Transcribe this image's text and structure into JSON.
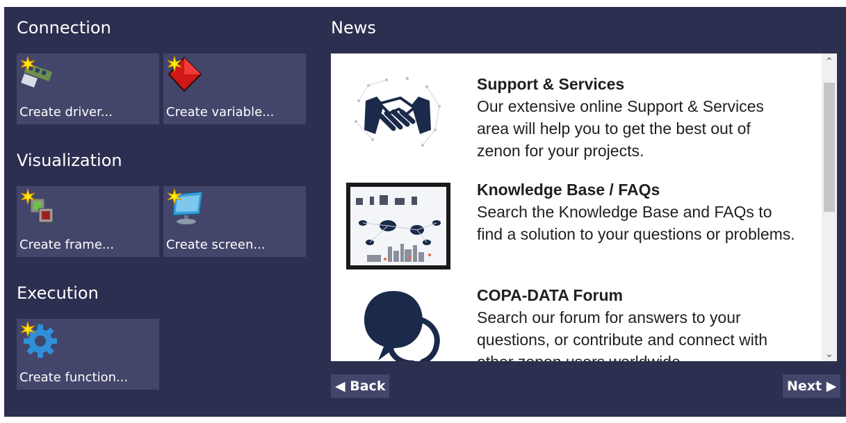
{
  "sections": {
    "connection": {
      "title": "Connection",
      "tiles": [
        {
          "label": "Create driver..."
        },
        {
          "label": "Create variable..."
        }
      ]
    },
    "visualization": {
      "title": "Visualization",
      "tiles": [
        {
          "label": "Create frame..."
        },
        {
          "label": "Create screen..."
        }
      ]
    },
    "execution": {
      "title": "Execution",
      "tiles": [
        {
          "label": "Create function..."
        }
      ]
    }
  },
  "news": {
    "title": "News",
    "items": [
      {
        "title": "Support & Services",
        "body": "Our extensive online Support & Services area will help you to get the best out of zenon for your projects.",
        "icon": "handshake-icon"
      },
      {
        "title": "Knowledge Base / FAQs",
        "body": "Search the Knowledge Base and FAQs to find a solution to your questions or problems.",
        "icon": "knowledge-base-image"
      },
      {
        "title": "COPA-DATA Forum",
        "body": "Search our forum for answers to your questions, or contribute and connect with other zenon users worldwide.",
        "icon": "speech-bubbles-icon"
      }
    ],
    "back_label": "Back",
    "next_label": "Next"
  },
  "colors": {
    "background": "#2c2f4f",
    "tile": "#43466a",
    "accent_star": "#ffee00"
  }
}
